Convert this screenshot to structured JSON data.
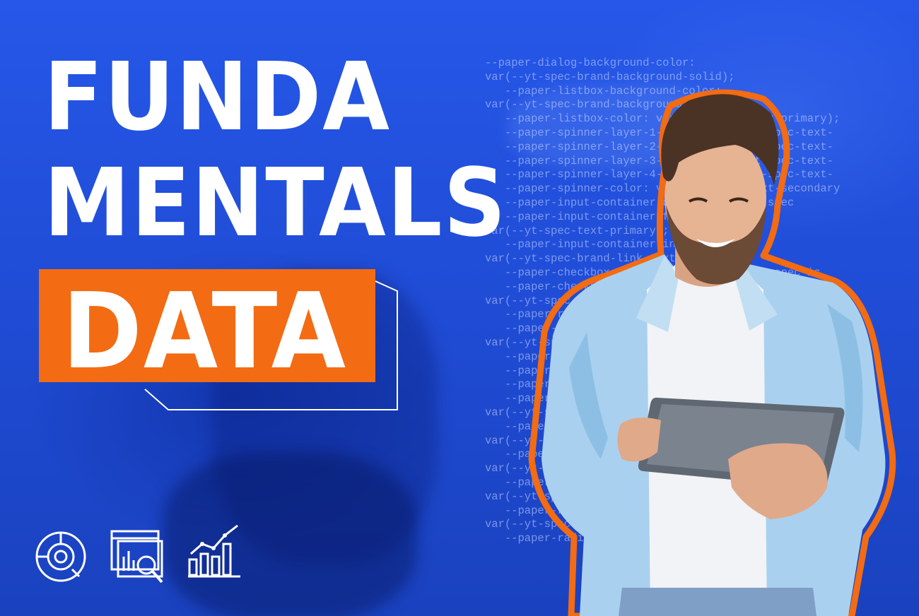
{
  "headline": {
    "line1": "FUNDA",
    "line2": "MENTALS",
    "highlight": "DATA"
  },
  "code_lines": [
    "--paper-dialog-background-color:",
    "var(--yt-spec-brand-background-solid);",
    "   --paper-listbox-background-color:",
    "var(--yt-spec-brand-background-solid);",
    "   --paper-listbox-color: var(--yt-spec-text-primary);",
    "   --paper-spinner-layer-1-color: var(--yt-spec-text-",
    "   --paper-spinner-layer-2-color: var(--yt-spec-text-",
    "   --paper-spinner-layer-3-color: var(--yt-spec-text-",
    "   --paper-spinner-layer-4-color: var(--yt-spec-text-",
    "   --paper-spinner-color: var(--yt-spec-text-secondary",
    "   --paper-input-container-color: var(--yt-spec",
    "   --paper-input-container-focus-color:",
    "var(--yt-spec-text-primary);",
    "   --paper-input-container-invalid-color:",
    "var(--yt-spec-brand-link-text);",
    "   --paper-checkbox-checked-color: var(--yt-spec-ic",
    "   --paper-checkbox-unchecked-color:",
    "var(--yt-spec-text-secondary);",
    "   --paper-radio-button-color: var(--yt-spec-call",
    "   --paper-radio-button-unchecked-color:",
    "var(--yt-spec-text-secondary);",
    "   --paper-toggle-button-color: var(--yt-spec-text-p",
    "   --paper-toggle-button-checked-color:",
    "   --paper-tooltip-background-color:",
    "   --paper-tooltip-text-color:",
    "var(--yt-spec-brand-button-background);",
    "   --paper-tabs-selection-bar-color:",
    "var(--yt-spec-text-primary);",
    "   --paper-item-selected-color:",
    "var(--yt-spec-brand-icon-active);",
    "   --paper-item-focused-color:",
    "var(--yt-spec-brand-background-solid);",
    "   --paper-radio-button-label-color:",
    "var(--yt-spec-general-background-a);",
    "   --paper-radio-button-ink-color:"
  ],
  "icons": [
    "donut-chart-icon",
    "analytics-search-icon",
    "bar-line-chart-icon"
  ],
  "colors": {
    "background": "#1f4fd6",
    "accent": "#f36b12",
    "text": "#ffffff"
  }
}
